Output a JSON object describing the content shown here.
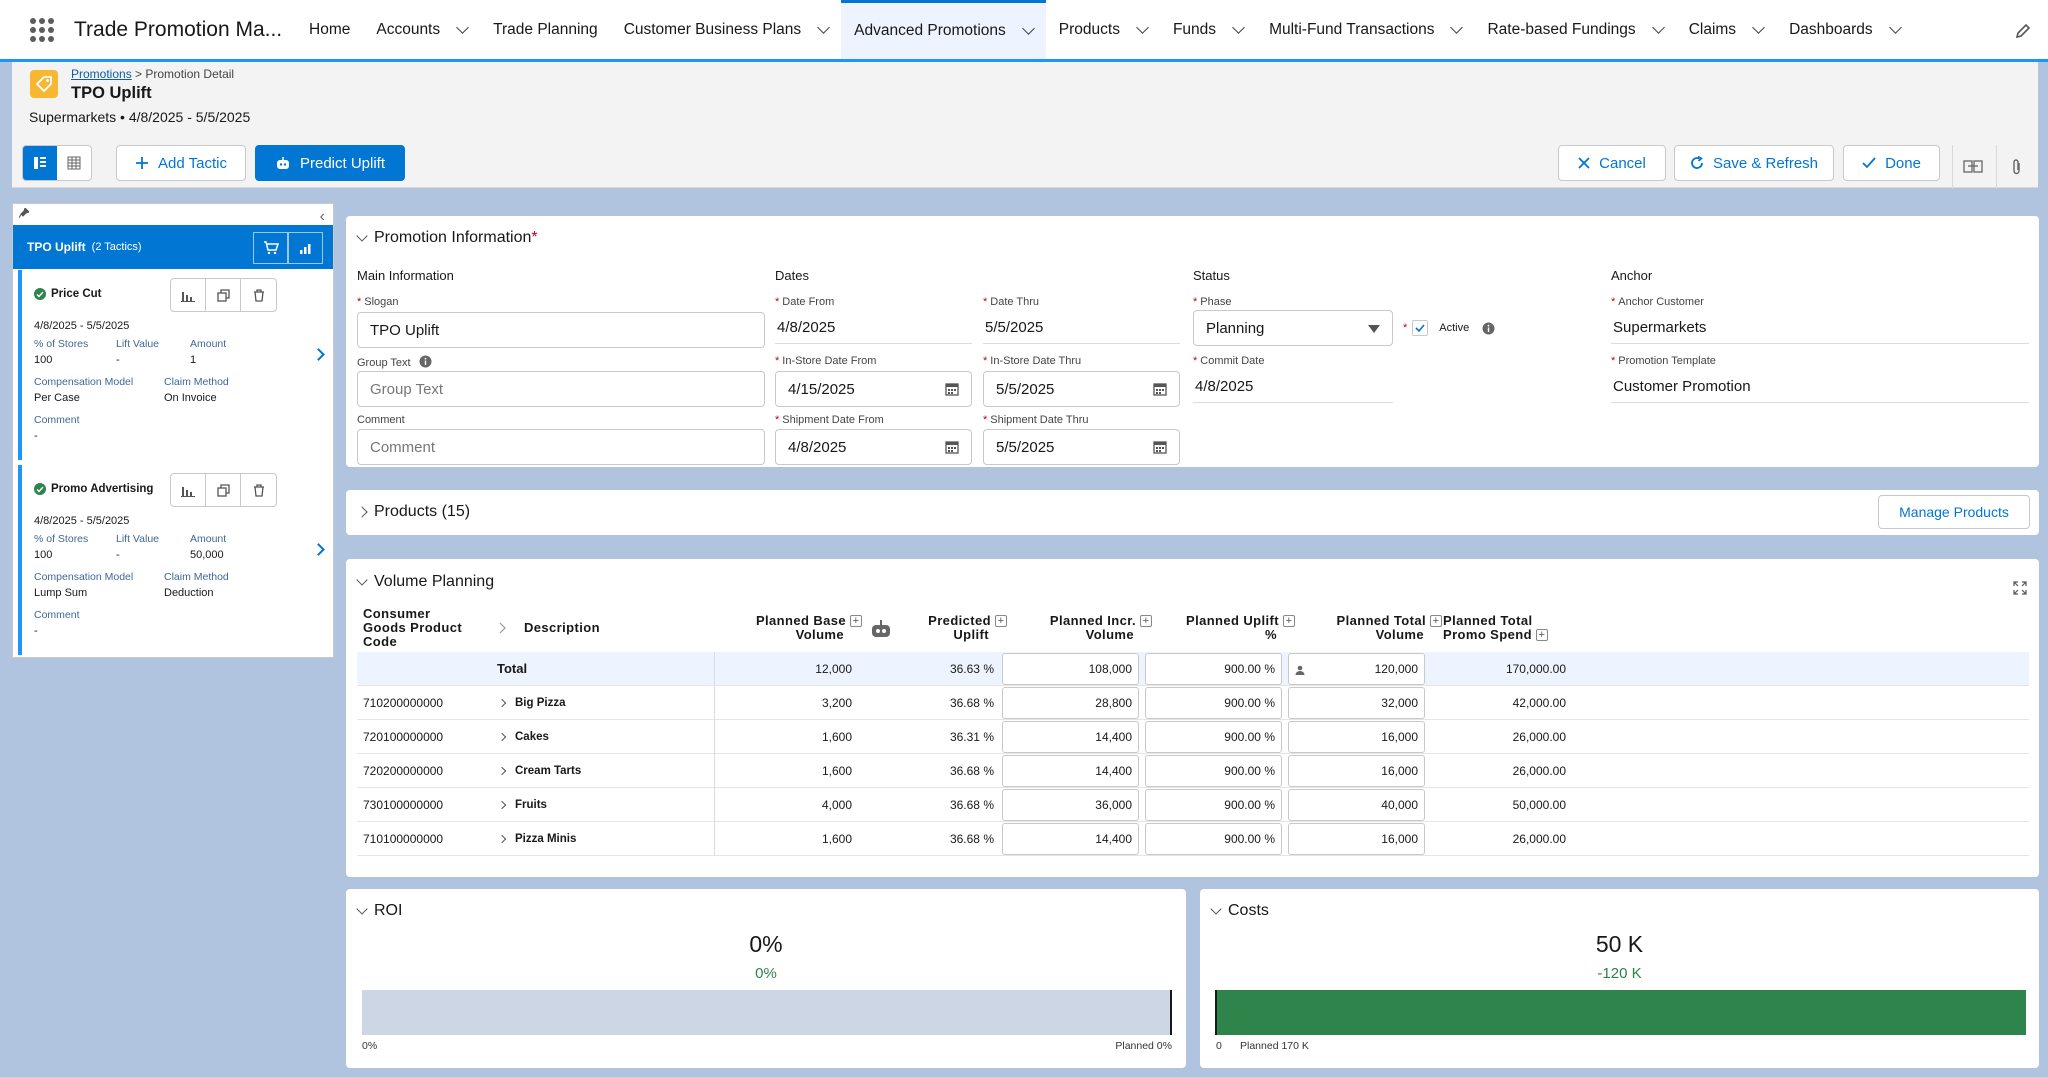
{
  "nav": {
    "app_name": "Trade Promotion Ma...",
    "tabs": [
      {
        "label": "Home",
        "dropdown": false
      },
      {
        "label": "Accounts",
        "dropdown": true
      },
      {
        "label": "Trade Planning",
        "dropdown": false
      },
      {
        "label": "Customer Business Plans",
        "dropdown": true
      },
      {
        "label": "Advanced Promotions",
        "dropdown": true,
        "active": true
      },
      {
        "label": "Products",
        "dropdown": true
      },
      {
        "label": "Funds",
        "dropdown": true
      },
      {
        "label": "Multi-Fund Transactions",
        "dropdown": true
      },
      {
        "label": "Rate-based Fundings",
        "dropdown": true
      },
      {
        "label": "Claims",
        "dropdown": true
      },
      {
        "label": "Dashboards",
        "dropdown": true
      }
    ]
  },
  "header": {
    "breadcrumb_link": "Promotions",
    "breadcrumb_rest": " > Promotion Detail",
    "title": "TPO Uplift",
    "subtitle": "Supermarkets • 4/8/2025 - 5/5/2025"
  },
  "toolbar": {
    "add_tactic": "Add Tactic",
    "predict_uplift": "Predict Uplift",
    "cancel": "Cancel",
    "save_refresh": "Save & Refresh",
    "done": "Done"
  },
  "left_panel": {
    "title": "TPO Uplift",
    "count": "(2 Tactics)",
    "tactics": [
      {
        "name": "Price Cut",
        "dates": "4/8/2025 - 5/5/2025",
        "stores_label": "% of Stores",
        "stores": "100",
        "lift_label": "Lift Value",
        "lift": "-",
        "amount_label": "Amount",
        "amount": "1",
        "comp_label": "Compensation Model",
        "comp": "Per Case",
        "claim_label": "Claim Method",
        "claim": "On Invoice",
        "comment_label": "Comment",
        "comment": "-"
      },
      {
        "name": "Promo Advertising",
        "dates": "4/8/2025 - 5/5/2025",
        "stores_label": "% of Stores",
        "stores": "100",
        "lift_label": "Lift Value",
        "lift": "-",
        "amount_label": "Amount",
        "amount": "50,000",
        "comp_label": "Compensation Model",
        "comp": "Lump Sum",
        "claim_label": "Claim Method",
        "claim": "Deduction",
        "comment_label": "Comment",
        "comment": "-"
      }
    ]
  },
  "promo_info": {
    "title": "Promotion Information",
    "main_section": "Main Information",
    "dates_section": "Dates",
    "status_section": "Status",
    "anchor_section": "Anchor",
    "slogan_label": "Slogan",
    "slogan": "TPO Uplift",
    "group_label": "Group Text",
    "group_placeholder": "Group Text",
    "comment_label": "Comment",
    "comment_placeholder": "Comment",
    "date_from_label": "Date From",
    "date_from": "4/8/2025",
    "date_thru_label": "Date Thru",
    "date_thru": "5/5/2025",
    "instore_from_label": "In-Store Date From",
    "instore_from": "4/15/2025",
    "instore_thru_label": "In-Store Date Thru",
    "instore_thru": "5/5/2025",
    "ship_from_label": "Shipment Date From",
    "ship_from": "4/8/2025",
    "ship_thru_label": "Shipment Date Thru",
    "ship_thru": "5/5/2025",
    "phase_label": "Phase",
    "phase": "Planning",
    "active_label": "Active",
    "commit_label": "Commit Date",
    "commit": "4/8/2025",
    "anchor_customer_label": "Anchor Customer",
    "anchor_customer": "Supermarkets",
    "template_label": "Promotion Template",
    "template": "Customer Promotion"
  },
  "products": {
    "title": "Products (15)",
    "manage": "Manage Products"
  },
  "volume": {
    "title": "Volume Planning",
    "headers": {
      "code": [
        "Consumer",
        "Goods Product",
        "Code"
      ],
      "description": "Description",
      "base": [
        "Planned Base",
        "Volume"
      ],
      "predicted": [
        "Predicted",
        "Uplift"
      ],
      "incr": [
        "Planned Incr.",
        "Volume"
      ],
      "uplift": [
        "Planned Uplift",
        "%"
      ],
      "total_vol": [
        "Planned Total",
        "Volume"
      ],
      "total_spend": [
        "Planned Total",
        "Promo Spend"
      ]
    },
    "rows": [
      {
        "code": "",
        "desc": "Total",
        "base": "12,000",
        "pred": "36.63 %",
        "incr": "108,000",
        "uplift": "900.00 %",
        "tvol": "120,000",
        "spend": "170,000.00"
      },
      {
        "code": "710200000000",
        "desc": "Big Pizza",
        "base": "3,200",
        "pred": "36.68 %",
        "incr": "28,800",
        "uplift": "900.00 %",
        "tvol": "32,000",
        "spend": "42,000.00"
      },
      {
        "code": "720100000000",
        "desc": "Cakes",
        "base": "1,600",
        "pred": "36.31 %",
        "incr": "14,400",
        "uplift": "900.00 %",
        "tvol": "16,000",
        "spend": "26,000.00"
      },
      {
        "code": "720200000000",
        "desc": "Cream Tarts",
        "base": "1,600",
        "pred": "36.68 %",
        "incr": "14,400",
        "uplift": "900.00 %",
        "tvol": "16,000",
        "spend": "26,000.00"
      },
      {
        "code": "730100000000",
        "desc": "Fruits",
        "base": "4,000",
        "pred": "36.68 %",
        "incr": "36,000",
        "uplift": "900.00 %",
        "tvol": "40,000",
        "spend": "50,000.00"
      },
      {
        "code": "710100000000",
        "desc": "Pizza Minis",
        "base": "1,600",
        "pred": "36.68 %",
        "incr": "14,400",
        "uplift": "900.00 %",
        "tvol": "16,000",
        "spend": "26,000.00"
      }
    ]
  },
  "roi": {
    "title": "ROI",
    "value": "0%",
    "delta": "0%",
    "axis_min": "0%",
    "planned_label": "Planned 0%",
    "fill_fraction": 0
  },
  "costs": {
    "title": "Costs",
    "value": "50 K",
    "delta": "-120 K",
    "axis_min": "0",
    "planned_label": "Planned 170 K",
    "fill_fraction": 1
  },
  "colors": {
    "brand": "#0176d3",
    "success": "#2e844a",
    "background": "#b0c4df"
  }
}
